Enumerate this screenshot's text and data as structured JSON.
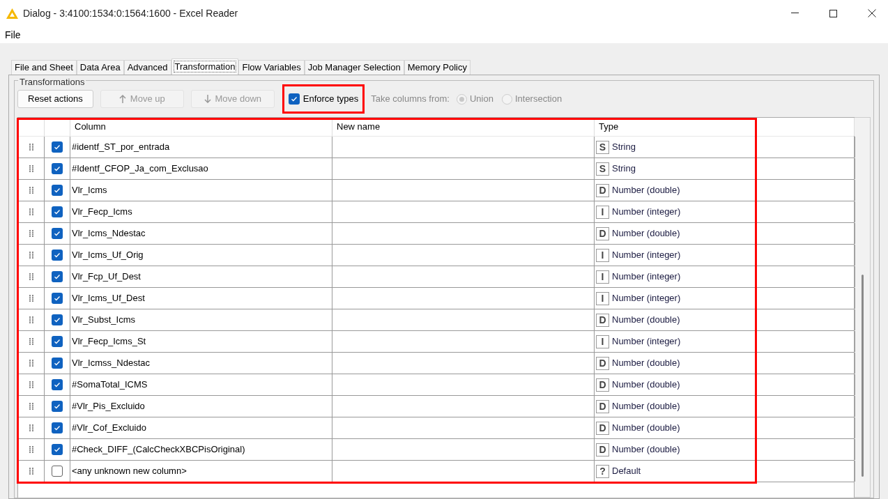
{
  "window": {
    "title": "Dialog - 3:4100:1534:0:1564:1600 - Excel Reader"
  },
  "menu": [
    "File"
  ],
  "tabs": [
    {
      "label": "File and Sheet",
      "selected": false
    },
    {
      "label": "Data Area",
      "selected": false
    },
    {
      "label": "Advanced",
      "selected": false
    },
    {
      "label": "Transformation",
      "selected": true
    },
    {
      "label": "Flow Variables",
      "selected": false
    },
    {
      "label": "Job Manager Selection",
      "selected": false
    },
    {
      "label": "Memory Policy",
      "selected": false
    }
  ],
  "group": {
    "title": "Transformations",
    "toolbar": {
      "reset": {
        "label": "Reset actions",
        "disabled": false
      },
      "move_up": {
        "label": "Move up",
        "disabled": true
      },
      "move_down": {
        "label": "Move down",
        "disabled": true
      },
      "enforce_types": {
        "label": "Enforce types",
        "checked": true,
        "highlighted": true
      },
      "take_columns_label": "Take columns from:",
      "radios": [
        {
          "label": "Union",
          "selected": true,
          "disabled": true
        },
        {
          "label": "Intersection",
          "selected": false,
          "disabled": true
        }
      ]
    },
    "table": {
      "highlighted": true,
      "columns": [
        "Column",
        "New name",
        "Type"
      ],
      "rows": [
        {
          "checked": true,
          "column": "#identf_ST_por_entrada",
          "type_badge": "S",
          "type": "String"
        },
        {
          "checked": true,
          "column": "#Identf_CFOP_Ja_com_Exclusao",
          "type_badge": "S",
          "type": "String"
        },
        {
          "checked": true,
          "column": "Vlr_Icms",
          "type_badge": "D",
          "type": "Number (double)"
        },
        {
          "checked": true,
          "column": "Vlr_Fecp_Icms",
          "type_badge": "I",
          "type": "Number (integer)"
        },
        {
          "checked": true,
          "column": "Vlr_Icms_Ndestac",
          "type_badge": "D",
          "type": "Number (double)"
        },
        {
          "checked": true,
          "column": "Vlr_Icms_Uf_Orig",
          "type_badge": "I",
          "type": "Number (integer)"
        },
        {
          "checked": true,
          "column": "Vlr_Fcp_Uf_Dest",
          "type_badge": "I",
          "type": "Number (integer)"
        },
        {
          "checked": true,
          "column": "Vlr_Icms_Uf_Dest",
          "type_badge": "I",
          "type": "Number (integer)"
        },
        {
          "checked": true,
          "column": "Vlr_Subst_Icms",
          "type_badge": "D",
          "type": "Number (double)"
        },
        {
          "checked": true,
          "column": "Vlr_Fecp_Icms_St",
          "type_badge": "I",
          "type": "Number (integer)"
        },
        {
          "checked": true,
          "column": "Vlr_Icmss_Ndestac",
          "type_badge": "D",
          "type": "Number (double)"
        },
        {
          "checked": true,
          "column": "#SomaTotal_ICMS",
          "type_badge": "D",
          "type": "Number (double)"
        },
        {
          "checked": true,
          "column": "#Vlr_Pis_Excluido",
          "type_badge": "D",
          "type": "Number (double)"
        },
        {
          "checked": true,
          "column": "#Vlr_Cof_Excluido",
          "type_badge": "D",
          "type": "Number (double)"
        },
        {
          "checked": true,
          "column": "#Check_DIFF_(CalcCheckXBCPisOriginal)",
          "type_badge": "D",
          "type": "Number (double)"
        },
        {
          "checked": false,
          "column": "<any unknown new column>",
          "type_badge": "?",
          "type": "Default"
        }
      ]
    }
  }
}
